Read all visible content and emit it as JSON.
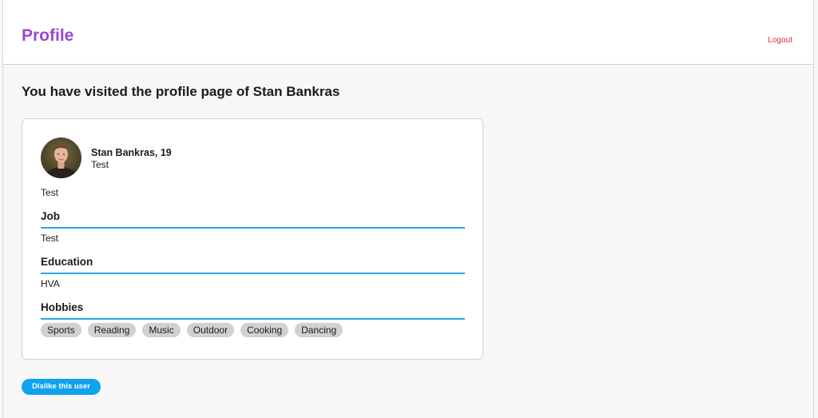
{
  "header": {
    "title": "Profile",
    "logout_label": "Logout"
  },
  "page": {
    "heading": "You have visited the profile page of Stan Bankras"
  },
  "profile": {
    "name_age": "Stan Bankras, 19",
    "subtitle": "Test",
    "bio": "Test",
    "avatar_icon": "user-photo",
    "sections": {
      "job": {
        "label": "Job",
        "value": "Test"
      },
      "education": {
        "label": "Education",
        "value": "HVA"
      },
      "hobbies": {
        "label": "Hobbies"
      }
    },
    "hobbies": [
      "Sports",
      "Reading",
      "Music",
      "Outdoor",
      "Cooking",
      "Dancing"
    ]
  },
  "actions": {
    "dislike_label": "Dislike this user"
  },
  "colors": {
    "brand_purple": "#9b46d6",
    "logout_red": "#e3243b",
    "accent_blue": "#2aa9e6",
    "button_blue": "#0fa2ee",
    "tag_gray": "#d1d1d1",
    "page_background": "#f7f7f7"
  }
}
